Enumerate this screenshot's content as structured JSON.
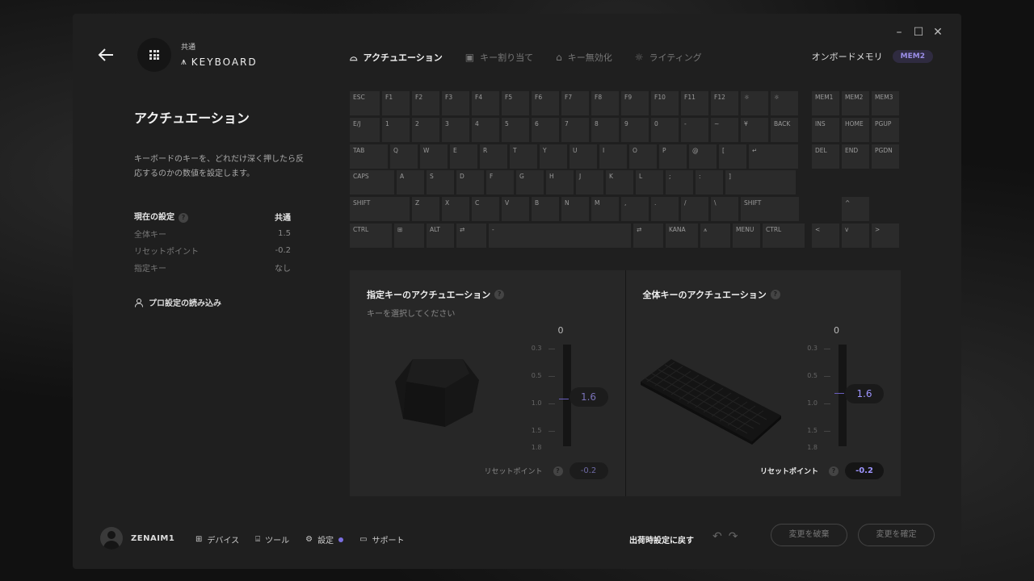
{
  "window": {
    "controls": {
      "minimize": "–",
      "maximize": "☐",
      "close": "✕"
    }
  },
  "app": {
    "sub": "共通",
    "title": "KEYBOARD"
  },
  "tabs": [
    {
      "label": "アクチュエーション",
      "icon": "keycap-icon",
      "active": true
    },
    {
      "label": "キー割り当て",
      "icon": "key-assign-icon"
    },
    {
      "label": "キー無効化",
      "icon": "lock-icon"
    },
    {
      "label": "ライティング",
      "icon": "sun-icon"
    }
  ],
  "memory": {
    "label": "オンボードメモリ",
    "value": "MEM2"
  },
  "left": {
    "title": "アクチュエーション",
    "description": "キーボードのキーを、どれだけ深く押したら反応するのかの数値を設定します。",
    "settings": {
      "header": "現在の設定",
      "header_value": "共通",
      "rows": [
        {
          "label": "全体キー",
          "value": "1.5"
        },
        {
          "label": "リセットポイント",
          "value": "-0.2"
        },
        {
          "label": "指定キー",
          "value": "なし"
        }
      ]
    },
    "pro_load": "プロ設定の読み込み"
  },
  "keyboard": {
    "rows": [
      [
        "ESC",
        "F1",
        "F2",
        "F3",
        "F4",
        "F5",
        "F6",
        "F7",
        "F8",
        "F9",
        "F10",
        "F11",
        "F12",
        "☼",
        "☼"
      ],
      [
        "E/J",
        "1",
        "2",
        "3",
        "4",
        "5",
        "6",
        "7",
        "8",
        "9",
        "0",
        "-",
        "~",
        "¥",
        "BACK"
      ],
      [
        "TAB",
        "Q",
        "W",
        "E",
        "R",
        "T",
        "Y",
        "U",
        "I",
        "O",
        "P",
        "@",
        "[",
        "↵"
      ],
      [
        "CAPS",
        "A",
        "S",
        "D",
        "F",
        "G",
        "H",
        "J",
        "K",
        "L",
        ";",
        ":",
        "]"
      ],
      [
        "SHIFT",
        "Z",
        "X",
        "C",
        "V",
        "B",
        "N",
        "M",
        ",",
        ".",
        "/",
        "\\",
        "SHIFT"
      ],
      [
        "CTRL",
        "⊞",
        "ALT",
        "⇄",
        "-",
        "⇄",
        "KANA",
        "⩚",
        "MENU",
        "CTRL"
      ]
    ],
    "nav": [
      [
        "MEM1",
        "MEM2",
        "MEM3"
      ],
      [
        "INS",
        "HOME",
        "PGUP"
      ],
      [
        "DEL",
        "END",
        "PGDN"
      ]
    ],
    "arrows": [
      "^",
      "<",
      "v",
      ">"
    ]
  },
  "panel_specific": {
    "title": "指定キーのアクチュエーション",
    "subtitle": "キーを選択してください",
    "top_value": "0",
    "scale": [
      "0.3",
      "0.5",
      "1.0",
      "1.5",
      "1.8"
    ],
    "value": "1.6",
    "reset_label": "リセットポイント",
    "reset_value": "-0.2"
  },
  "panel_global": {
    "title": "全体キーのアクチュエーション",
    "top_value": "0",
    "scale": [
      "0.3",
      "0.5",
      "1.0",
      "1.5",
      "1.8"
    ],
    "value": "1.6",
    "reset_label": "リセットポイント",
    "reset_value": "-0.2"
  },
  "footer": {
    "user": "ZENAIM1",
    "nav": [
      {
        "label": "デバイス",
        "icon": "device-icon"
      },
      {
        "label": "ツール",
        "icon": "tool-icon"
      },
      {
        "label": "設定",
        "icon": "gear-icon"
      },
      {
        "label": "サポート",
        "icon": "chat-icon"
      }
    ],
    "restore": "出荷時設定に戻す",
    "discard": "変更を破棄",
    "confirm": "変更を確定"
  },
  "colors": {
    "accent": "#9e95ff",
    "background": "#1f1f1f"
  }
}
